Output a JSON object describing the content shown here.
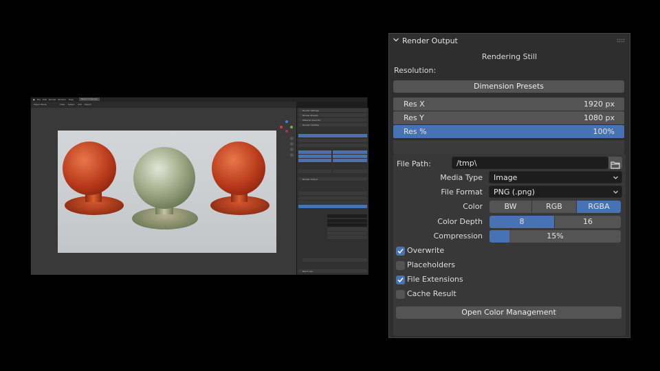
{
  "thumbnail": {
    "menu": [
      "File",
      "Edit",
      "Render",
      "Window",
      "Help"
    ],
    "workspace_tab": "Blend to Render",
    "viewport_menu": [
      "Object Mode",
      "View",
      "Select",
      "Add",
      "Object"
    ],
    "props_panels": [
      "Render Settings",
      "Render Presets",
      "Material Override",
      "Render Visibility",
      "Render Output",
      "Batch List"
    ]
  },
  "panel": {
    "title": "Render Output",
    "status": "Rendering Still",
    "resolution_label": "Resolution:",
    "dimension_presets": "Dimension Presets",
    "res_x_label": "Res X",
    "res_x_value": "1920 px",
    "res_y_label": "Res Y",
    "res_y_value": "1080 px",
    "res_pct_label": "Res %",
    "res_pct_value": "100%",
    "file_path_label": "File Path:",
    "file_path_value": "/tmp\\",
    "media_type_label": "Media Type",
    "media_type_value": "Image",
    "file_format_label": "File Format",
    "file_format_value": "PNG (.png)",
    "color_label": "Color",
    "color_options": [
      "BW",
      "RGB",
      "RGBA"
    ],
    "color_selected": "RGBA",
    "color_depth_label": "Color Depth",
    "color_depth_options": [
      "8",
      "16"
    ],
    "color_depth_selected": "8",
    "compression_label": "Compression",
    "compression_value": "15%",
    "compression_fraction": 0.15,
    "checkboxes": [
      {
        "label": "Overwrite",
        "checked": true
      },
      {
        "label": "Placeholders",
        "checked": false
      },
      {
        "label": "File Extensions",
        "checked": true
      },
      {
        "label": "Cache Result",
        "checked": false
      }
    ],
    "open_color_management": "Open Color Management",
    "accent": "#4772b3"
  }
}
